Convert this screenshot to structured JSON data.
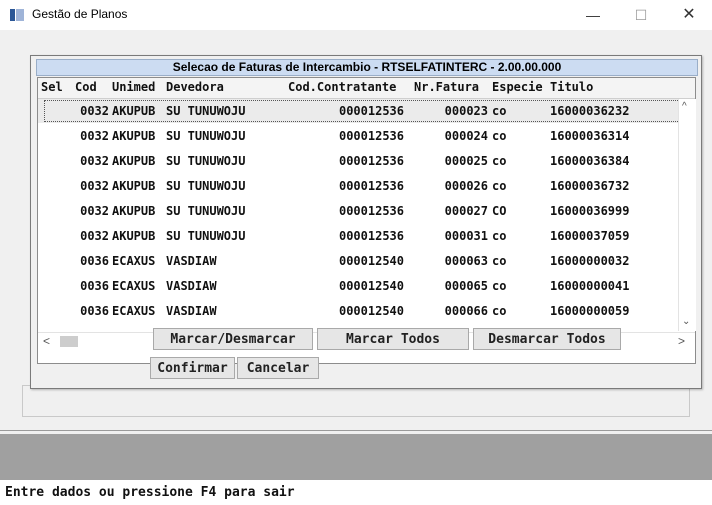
{
  "window": {
    "title": "Gestão de Planos",
    "minimize": "—",
    "maximize": "☐",
    "close": "✕"
  },
  "dialog": {
    "title": "Selecao de Faturas de Intercambio - RTSELFATINTERC - 2.00.00.000",
    "columns": [
      "Sel",
      "Cod",
      "Unimed",
      "Devedora",
      "Cod.Contratante",
      "Nr.Fatura",
      "Especie",
      "Titulo"
    ],
    "rows": [
      {
        "sel": "",
        "cod": "0032",
        "unimed": "AKUPUB",
        "devedora": "SU TUNUWOJU",
        "contratante": "000012536",
        "fatura": "000023",
        "especie": "co",
        "titulo": "16000036232"
      },
      {
        "sel": "",
        "cod": "0032",
        "unimed": "AKUPUB",
        "devedora": "SU TUNUWOJU",
        "contratante": "000012536",
        "fatura": "000024",
        "especie": "co",
        "titulo": "16000036314"
      },
      {
        "sel": "",
        "cod": "0032",
        "unimed": "AKUPUB",
        "devedora": "SU TUNUWOJU",
        "contratante": "000012536",
        "fatura": "000025",
        "especie": "co",
        "titulo": "16000036384"
      },
      {
        "sel": "",
        "cod": "0032",
        "unimed": "AKUPUB",
        "devedora": "SU TUNUWOJU",
        "contratante": "000012536",
        "fatura": "000026",
        "especie": "co",
        "titulo": "16000036732"
      },
      {
        "sel": "",
        "cod": "0032",
        "unimed": "AKUPUB",
        "devedora": "SU TUNUWOJU",
        "contratante": "000012536",
        "fatura": "000027",
        "especie": "CO",
        "titulo": "16000036999"
      },
      {
        "sel": "",
        "cod": "0032",
        "unimed": "AKUPUB",
        "devedora": "SU TUNUWOJU",
        "contratante": "000012536",
        "fatura": "000031",
        "especie": "co",
        "titulo": "16000037059"
      },
      {
        "sel": "",
        "cod": "0036",
        "unimed": "ECAXUS",
        "devedora": "VASDIAW",
        "contratante": "000012540",
        "fatura": "000063",
        "especie": "co",
        "titulo": "16000000032"
      },
      {
        "sel": "",
        "cod": "0036",
        "unimed": "ECAXUS",
        "devedora": "VASDIAW",
        "contratante": "000012540",
        "fatura": "000065",
        "especie": "co",
        "titulo": "16000000041"
      },
      {
        "sel": "",
        "cod": "0036",
        "unimed": "ECAXUS",
        "devedora": "VASDIAW",
        "contratante": "000012540",
        "fatura": "000066",
        "especie": "co",
        "titulo": "16000000059"
      }
    ],
    "buttons": {
      "marcar_desmarcar": "Marcar/Desmarcar",
      "marcar_todos": "Marcar Todos",
      "desmarcar_todos": "Desmarcar Todos",
      "confirmar": "Confirmar",
      "cancelar": "Cancelar"
    },
    "scroll": {
      "up": "^",
      "down": "⌄",
      "left": "<",
      "right": ">"
    }
  },
  "status": {
    "text": "Entre dados ou pressione F4 para sair"
  },
  "colors": {
    "dialog_title_bg": "#ccdcf2",
    "selected_row": "#ebebeb",
    "gray_strip": "#a0a0a0"
  }
}
